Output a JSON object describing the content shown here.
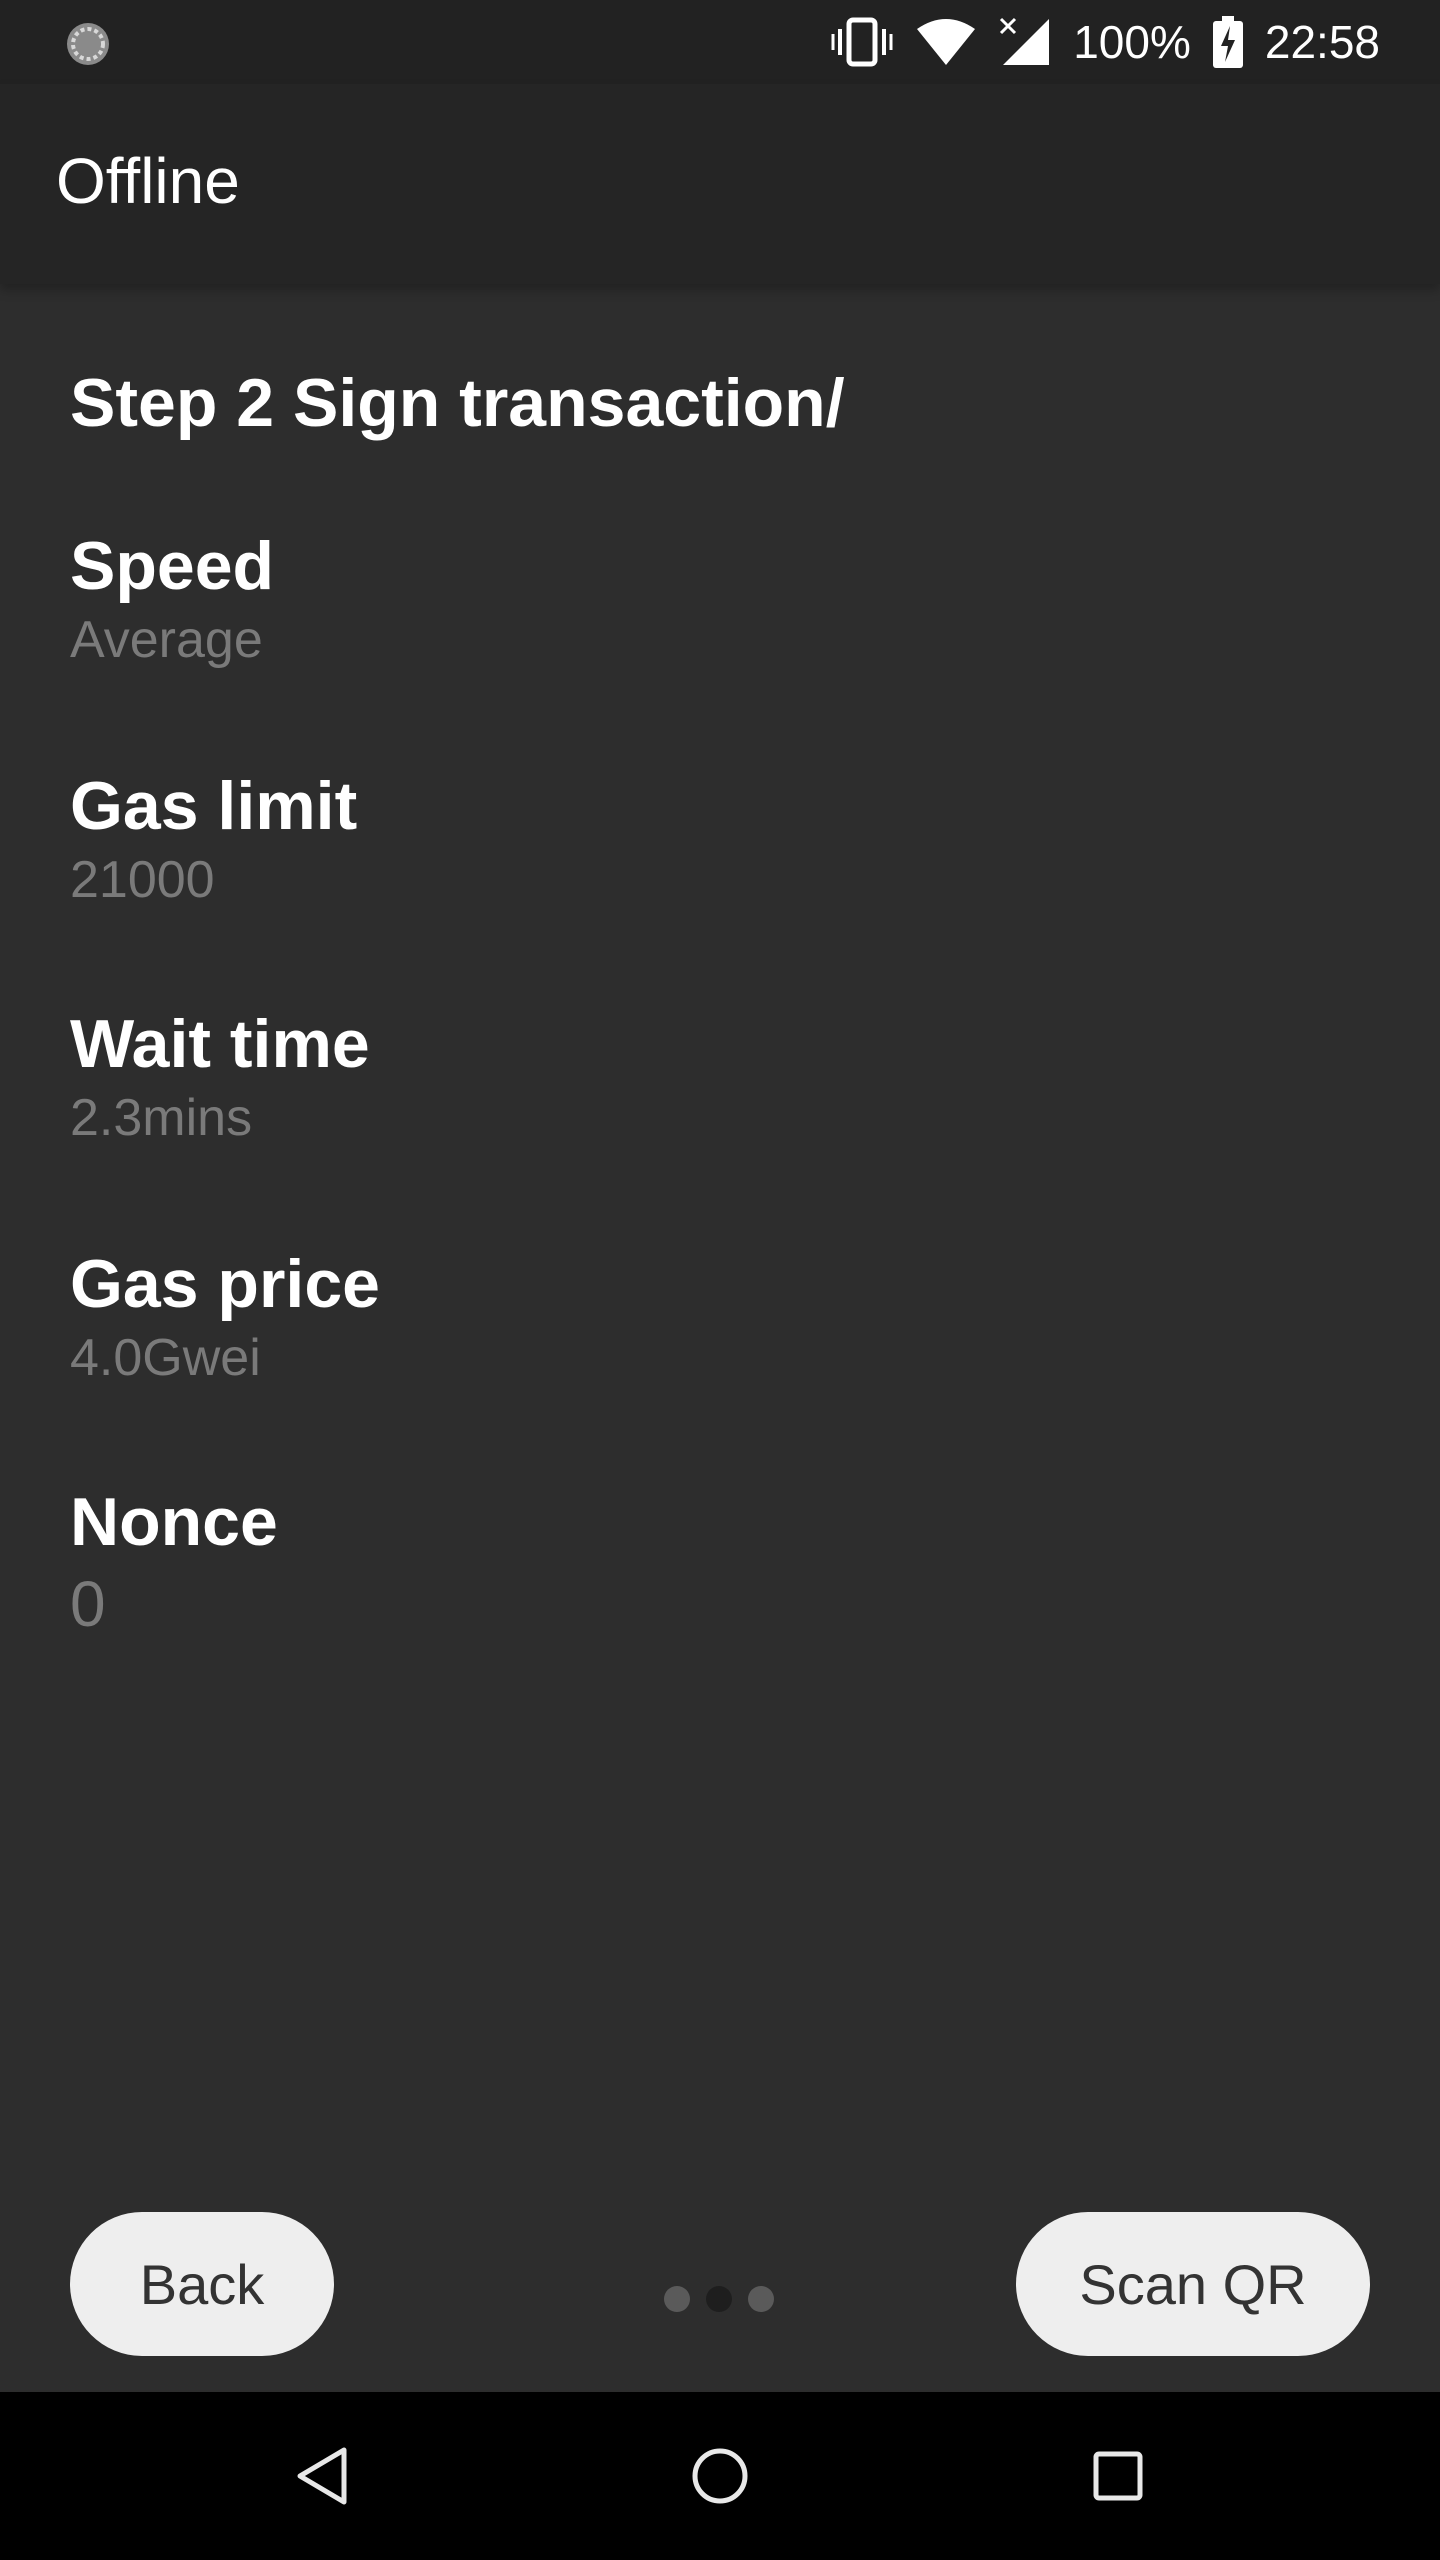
{
  "status_bar": {
    "battery": "100%",
    "time": "22:58",
    "icons": [
      "sync-icon",
      "vibrate-icon",
      "wifi-icon",
      "signal-icon",
      "battery-charging-icon"
    ]
  },
  "toolbar": {
    "title": "Offline"
  },
  "main": {
    "step_title": "Step 2 Sign transaction/",
    "fields": [
      {
        "label": "Speed",
        "value": "Average"
      },
      {
        "label": "Gas limit",
        "value": "21000"
      },
      {
        "label": "Wait time",
        "value": "2.3mins"
      },
      {
        "label": "Gas price",
        "value": "4.0Gwei"
      },
      {
        "label": "Nonce",
        "value": "0"
      }
    ]
  },
  "footer": {
    "back_label": "Back",
    "scan_label": "Scan QR",
    "pager": {
      "count": 3,
      "active_index": 1
    }
  },
  "nav_bar": {
    "icons": [
      "back-icon",
      "home-icon",
      "recents-icon"
    ]
  }
}
